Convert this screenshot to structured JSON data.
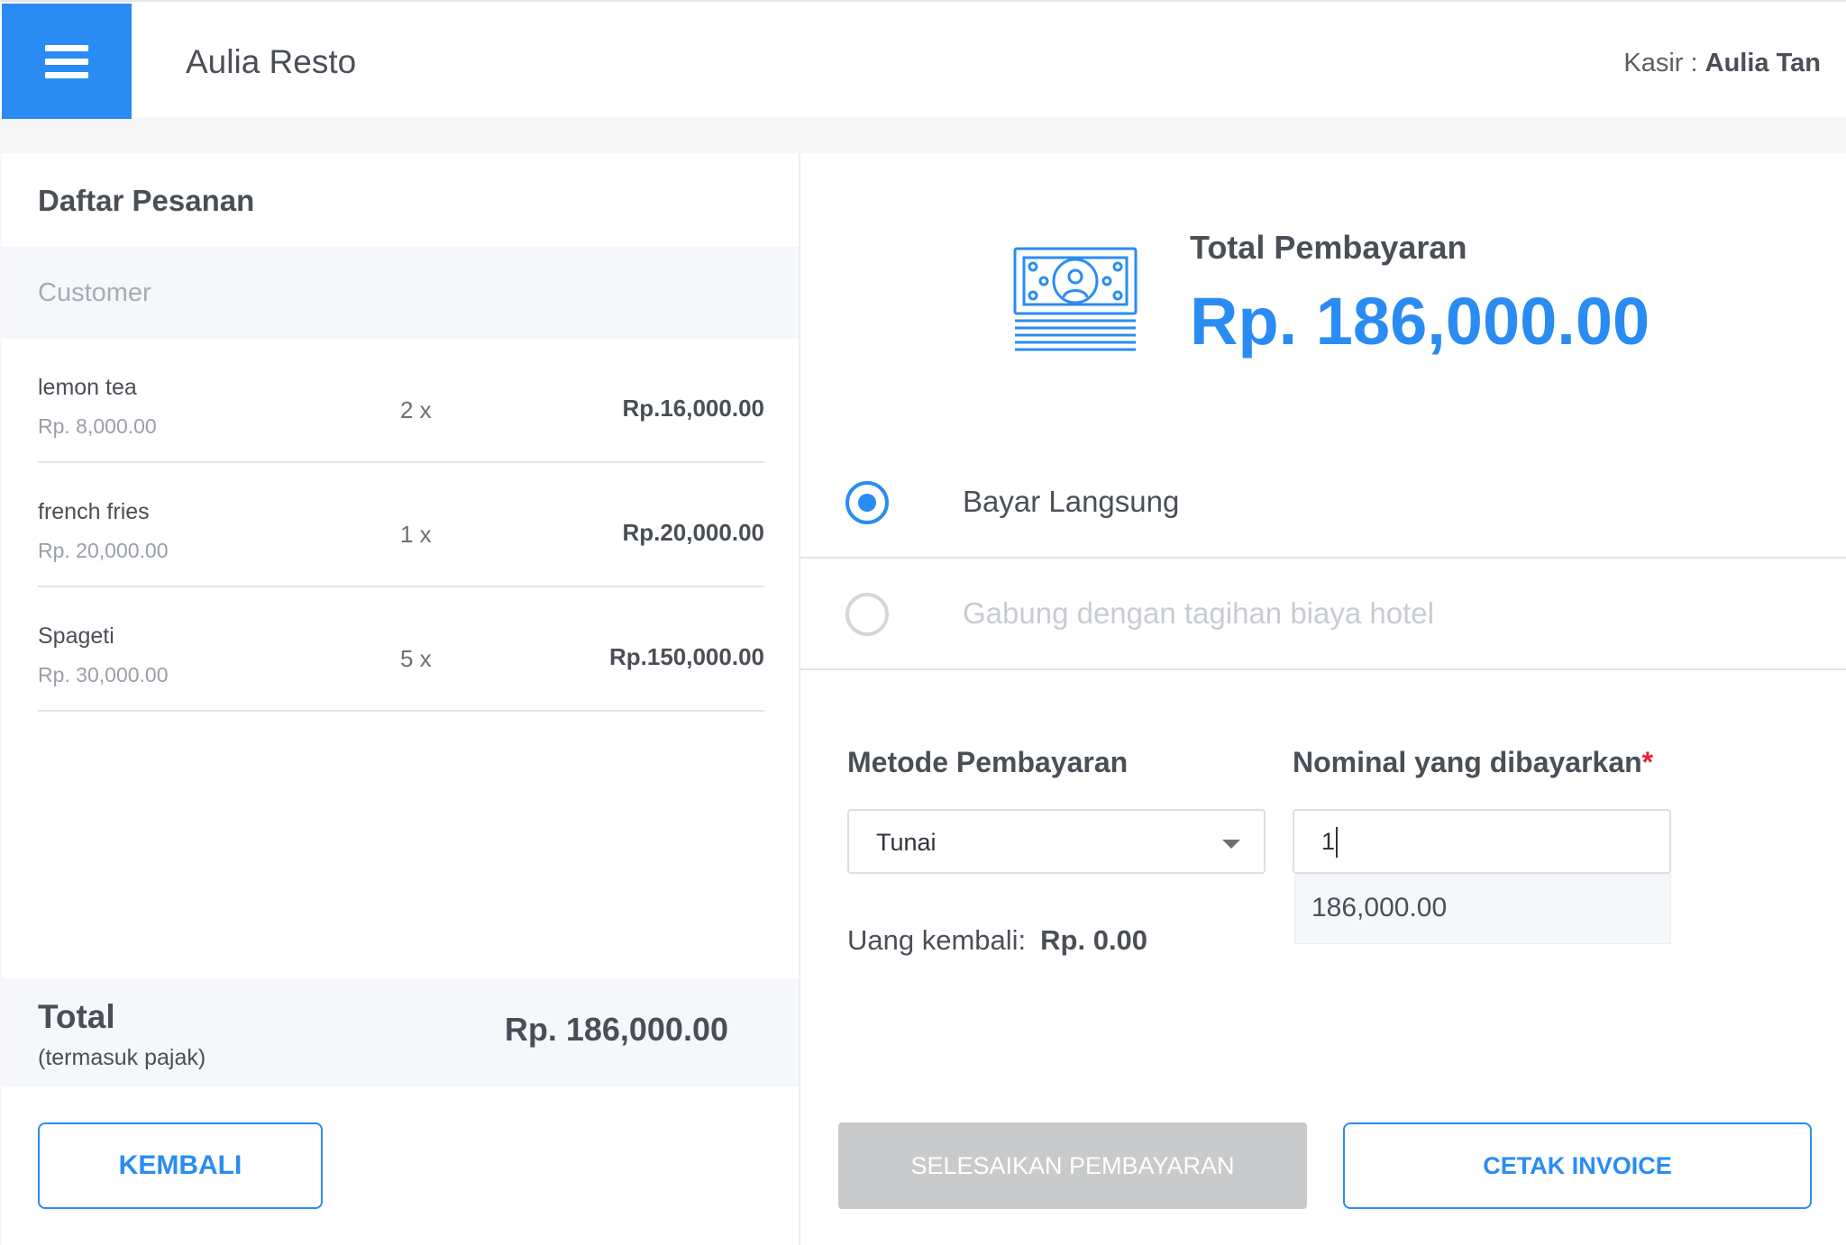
{
  "header": {
    "menu_icon": "hamburger-menu-icon",
    "brand": "Aulia Resto",
    "cashier_label": "Kasir :",
    "cashier_name": "Aulia Tan"
  },
  "order": {
    "title": "Daftar Pesanan",
    "customer_placeholder": "Customer",
    "items": [
      {
        "name": "lemon tea",
        "unit_price": "Rp. 8,000.00",
        "qty": "2 x",
        "subtotal": "Rp.16,000.00"
      },
      {
        "name": "french fries",
        "unit_price": "Rp. 20,000.00",
        "qty": "1 x",
        "subtotal": "Rp.20,000.00"
      },
      {
        "name": "Spageti",
        "unit_price": "Rp. 30,000.00",
        "qty": "5 x",
        "subtotal": "Rp.150,000.00"
      }
    ],
    "total_label": "Total",
    "total_note": "(termasuk pajak)",
    "total_amount": "Rp. 186,000.00",
    "back_button": "KEMBALI"
  },
  "payment": {
    "icon": "money-bill-icon",
    "title": "Total Pembayaran",
    "amount": "Rp. 186,000.00",
    "options": [
      {
        "label": "Bayar Langsung",
        "selected": true
      },
      {
        "label": "Gabung dengan tagihan biaya hotel",
        "selected": false
      }
    ],
    "method_label": "Metode Pembayaran",
    "method_value": "Tunai",
    "nominal_label": "Nominal yang dibayarkan",
    "required_mark": "*",
    "nominal_value": "1",
    "suggestion": "186,000.00",
    "change_label": "Uang kembali:",
    "change_value": "Rp. 0.00",
    "finish_button": "SELESAIKAN PEMBAYARAN",
    "invoice_button": "CETAK INVOICE"
  },
  "colors": {
    "accent": "#2a8cf3",
    "required": "#e5222e",
    "disabled_button": "#c9cacc"
  }
}
